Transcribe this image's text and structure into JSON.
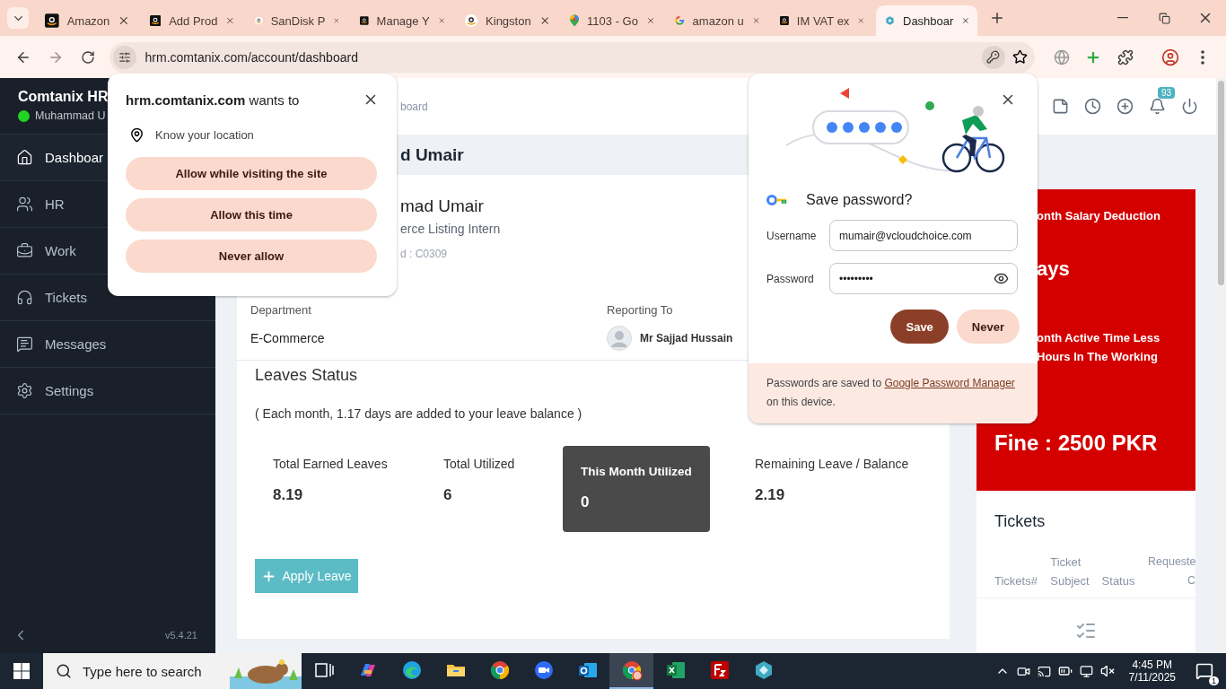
{
  "browser": {
    "tabs": [
      {
        "title": "Amazon",
        "kind": "amazon-dark",
        "selected": false
      },
      {
        "title": "Add Prod",
        "kind": "amazon-dark",
        "selected": false
      },
      {
        "title": "SanDisk P",
        "kind": "amazon-light",
        "selected": false
      },
      {
        "title": "Manage Y",
        "kind": "amazon-dark",
        "selected": false
      },
      {
        "title": "Kingston",
        "kind": "amazon-light",
        "selected": false
      },
      {
        "title": "1103 - Go",
        "kind": "maps",
        "selected": false
      },
      {
        "title": "amazon u",
        "kind": "google",
        "selected": false
      },
      {
        "title": "IM VAT ex",
        "kind": "amazon-dark",
        "selected": false
      },
      {
        "title": "Dashboar",
        "kind": "app",
        "selected": true
      }
    ],
    "address": "hrm.comtanix.com/account/dashboard"
  },
  "sidebar": {
    "brand": "Comtanix HR",
    "user": "Muhammad U",
    "online": true,
    "items": [
      {
        "label": "Dashboar",
        "kind": "home",
        "selected": true
      },
      {
        "label": "HR",
        "kind": "users",
        "selected": false
      },
      {
        "label": "Work",
        "kind": "briefcase",
        "selected": false
      },
      {
        "label": "Tickets",
        "kind": "headset",
        "selected": false
      },
      {
        "label": "Messages",
        "kind": "message",
        "selected": false
      },
      {
        "label": "Settings",
        "kind": "settings",
        "selected": false
      }
    ],
    "version": "v5.4.21"
  },
  "header": {
    "breadcrumb": "board",
    "notification_count": "93"
  },
  "profile": {
    "heading": "d Umair",
    "name": "mad Umair",
    "role": "erce Listing Intern",
    "employee_id": "d : C0309",
    "department_label": "Department",
    "reporting_label": "Reporting To",
    "department": "E-Commerce",
    "reporting_to": "Mr Sajjad Hussain"
  },
  "leaves": {
    "title": "Leaves Status",
    "note": "( Each month, 1.17 days are added to your leave balance )",
    "stats": [
      {
        "label": "Total Earned Leaves",
        "value": "8.19",
        "highlighted": false
      },
      {
        "label": "Total Utilized",
        "value": "6",
        "highlighted": false
      },
      {
        "label": "This Month Utilized",
        "value": "0",
        "highlighted": true
      },
      {
        "label": "Remaining Leave / Balance",
        "value": "2.19",
        "highlighted": false
      }
    ],
    "apply_button": "Apply Leave"
  },
  "fine_card": {
    "line_1": "onth Salary Deduction",
    "days": "ays",
    "line_2": "onth Active Time Less",
    "line_3": "Hours In The Working",
    "fine": "Fine : 2500 PKR"
  },
  "tickets": {
    "title": "Tickets",
    "columns": [
      "Tickets#",
      "Ticket Subject",
      "Status",
      "Requeste C"
    ]
  },
  "location_prompt": {
    "title": "**hrm.comtanix.com** wants to",
    "permission": "Know your location",
    "buttons": [
      "Allow while visiting the site",
      "Allow this time",
      "Never allow"
    ]
  },
  "password_prompt": {
    "title": "Save password?",
    "username_label": "Username",
    "username": "mumair@vcloudchoice.com",
    "password_label": "Password",
    "password": "•••••••••",
    "buttons": [
      {
        "label": "Save",
        "kind": "primary"
      },
      {
        "label": "Never",
        "kind": "secondary"
      }
    ],
    "footer": "Passwords are saved to",
    "link": "Google Password Manager",
    "footer_end": "on this device."
  },
  "taskbar": {
    "search_placeholder": "Type here to search",
    "apps": [
      {
        "kind": "task-view",
        "active": false
      },
      {
        "kind": "copilot",
        "active": false
      },
      {
        "kind": "edge",
        "active": false
      },
      {
        "kind": "explorer",
        "active": false
      },
      {
        "kind": "chrome",
        "active": false
      },
      {
        "kind": "zoom",
        "active": false
      },
      {
        "kind": "outlook",
        "active": false
      },
      {
        "kind": "chrome-profile",
        "active": true
      },
      {
        "kind": "excel",
        "active": false
      },
      {
        "kind": "filezilla",
        "active": false
      },
      {
        "kind": "hex-app",
        "active": false
      }
    ],
    "time": "4:45 PM",
    "date": "7/11/2025",
    "notifications": "1"
  }
}
